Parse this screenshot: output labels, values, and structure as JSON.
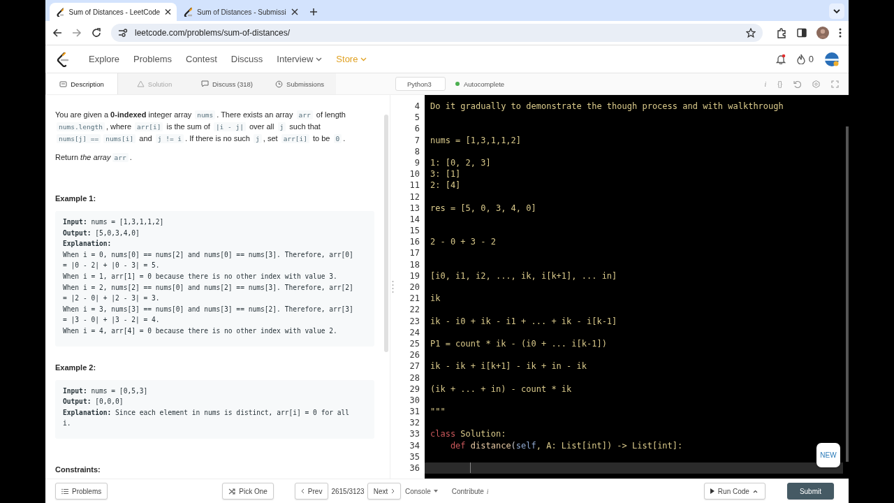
{
  "browser": {
    "tabs": [
      {
        "title": "Sum of Distances - LeetCode",
        "selected": true
      },
      {
        "title": "Sum of Distances - Submissi",
        "selected": false
      }
    ],
    "url": "leetcode.com/problems/sum-of-distances/"
  },
  "nav": {
    "items": [
      {
        "label": "Explore",
        "dropdown": false,
        "highlighted": false
      },
      {
        "label": "Problems",
        "dropdown": false,
        "highlighted": false
      },
      {
        "label": "Contest",
        "dropdown": false,
        "highlighted": false
      },
      {
        "label": "Discuss",
        "dropdown": false,
        "highlighted": false
      },
      {
        "label": "Interview",
        "dropdown": true,
        "highlighted": false
      },
      {
        "label": "Store",
        "dropdown": true,
        "highlighted": true
      }
    ],
    "streak": "0"
  },
  "panel_tabs": [
    {
      "label": "Description",
      "selected": true,
      "disabled": false
    },
    {
      "label": "Solution",
      "selected": false,
      "disabled": true
    },
    {
      "label": "Discuss (318)",
      "selected": false,
      "disabled": false
    },
    {
      "label": "Submissions",
      "selected": false,
      "disabled": false
    }
  ],
  "description": {
    "paragraphs": [
      [
        {
          "text": "You are given a ",
          "kind": "text"
        },
        {
          "text": "0-indexed",
          "kind": "bold"
        },
        {
          "text": " integer array ",
          "kind": "text"
        },
        {
          "text": "nums",
          "kind": "code"
        },
        {
          "text": ". There exists an array ",
          "kind": "text"
        },
        {
          "text": "arr",
          "kind": "code"
        },
        {
          "text": " of length ",
          "kind": "text"
        },
        {
          "text": "nums.length",
          "kind": "code"
        },
        {
          "text": ", where ",
          "kind": "text"
        },
        {
          "text": "arr[i]",
          "kind": "code"
        },
        {
          "text": " is the sum of ",
          "kind": "text"
        },
        {
          "text": "|i - j|",
          "kind": "code"
        },
        {
          "text": " over all ",
          "kind": "text"
        },
        {
          "text": "j",
          "kind": "code"
        },
        {
          "text": " such that ",
          "kind": "text"
        },
        {
          "text": "nums[j] ==",
          "kind": "code"
        },
        {
          "text": "nums[i]",
          "kind": "code"
        },
        {
          "text": " and ",
          "kind": "text"
        },
        {
          "text": "j != i",
          "kind": "code"
        },
        {
          "text": ". If there is no such ",
          "kind": "text"
        },
        {
          "text": "j",
          "kind": "code"
        },
        {
          "text": ", set ",
          "kind": "text"
        },
        {
          "text": "arr[i]",
          "kind": "code"
        },
        {
          "text": " to be ",
          "kind": "text"
        },
        {
          "text": "0",
          "kind": "code"
        },
        {
          "text": ".",
          "kind": "text"
        }
      ],
      [
        {
          "text": "Return ",
          "kind": "text"
        },
        {
          "text": "the array",
          "kind": "italic"
        },
        {
          "text": "arr",
          "kind": "code"
        },
        {
          "text": ".",
          "kind": "text"
        }
      ]
    ],
    "examples": [
      {
        "title": "Example 1:",
        "lines": [
          "**Input:** nums = [1,3,1,1,2]",
          "**Output:** [5,0,3,4,0]",
          "**Explanation:**",
          "When i = 0, nums[0] == nums[2] and nums[0] == nums[3]. Therefore, arr[0]",
          "= |0 - 2| + |0 - 3| = 5.",
          "When i = 1, arr[1] = 0 because there is no other index with value 3.",
          "When i = 2, nums[2] == nums[0] and nums[2] == nums[3]. Therefore, arr[2]",
          "= |2 - 0| + |2 - 3| = 3.",
          "When i = 3, nums[3] == nums[0] and nums[3] == nums[2]. Therefore, arr[3]",
          "= |3 - 0| + |3 - 2| = 4.",
          "When i = 4, arr[4] = 0 because there is no other index with value 2."
        ]
      },
      {
        "title": "Example 2:",
        "lines": [
          "**Input:** nums = [0,5,3]",
          "**Output:** [0,0,0]",
          "**Explanation:** Since each element in nums is distinct, arr[i] = 0 for all",
          "i."
        ]
      }
    ],
    "constraints_title": "Constraints:"
  },
  "editor": {
    "language": "Python3",
    "autocomplete": {
      "label": "Autocomplete",
      "on": true
    },
    "tools": [
      "i",
      "{}"
    ],
    "badge": "NEW",
    "lines": [
      {
        "number": "4",
        "active": false,
        "tokens": [
          {
            "text": "Do it gradually to demonstrate the though process and with walkthrough",
            "kind": "string"
          }
        ]
      },
      {
        "number": "5",
        "active": false
      },
      {
        "number": "6",
        "active": false
      },
      {
        "number": "7",
        "active": false,
        "tokens": [
          {
            "text": "nums = [1,3,1,1,2]",
            "kind": "string"
          }
        ]
      },
      {
        "number": "8",
        "active": false
      },
      {
        "number": "9",
        "active": false,
        "tokens": [
          {
            "text": "1: [0, 2, 3]",
            "kind": "string"
          }
        ]
      },
      {
        "number": "10",
        "active": false,
        "tokens": [
          {
            "text": "3: [1]",
            "kind": "string"
          }
        ]
      },
      {
        "number": "11",
        "active": false,
        "tokens": [
          {
            "text": "2: [4]",
            "kind": "string"
          }
        ]
      },
      {
        "number": "12",
        "active": false
      },
      {
        "number": "13",
        "active": false,
        "tokens": [
          {
            "text": "res = [5, 0, 3, 4, 0]",
            "kind": "string"
          }
        ]
      },
      {
        "number": "14",
        "active": false
      },
      {
        "number": "15",
        "active": false
      },
      {
        "number": "16",
        "active": false,
        "tokens": [
          {
            "text": "2 - 0 + 3 - 2",
            "kind": "string"
          }
        ]
      },
      {
        "number": "17",
        "active": false
      },
      {
        "number": "18",
        "active": false
      },
      {
        "number": "19",
        "active": false,
        "tokens": [
          {
            "text": "[i0, i1, i2, ..., ik, i[k+1], ... in]",
            "kind": "string"
          }
        ]
      },
      {
        "number": "20",
        "active": false
      },
      {
        "number": "21",
        "active": false,
        "tokens": [
          {
            "text": "ik",
            "kind": "string"
          }
        ]
      },
      {
        "number": "22",
        "active": false
      },
      {
        "number": "23",
        "active": false,
        "tokens": [
          {
            "text": "ik - i0 + ik - i1 + ... + ik - i[k-1]",
            "kind": "string"
          }
        ]
      },
      {
        "number": "24",
        "active": false
      },
      {
        "number": "25",
        "active": false,
        "tokens": [
          {
            "text": "P1 = count * ik - (i0 + ... i[k-1])",
            "kind": "string"
          }
        ]
      },
      {
        "number": "26",
        "active": false
      },
      {
        "number": "27",
        "active": false,
        "tokens": [
          {
            "text": "ik - ik + i[k+1] - ik + in - ik",
            "kind": "string"
          }
        ]
      },
      {
        "number": "28",
        "active": false
      },
      {
        "number": "29",
        "active": false,
        "tokens": [
          {
            "text": "(ik + ... + in) - count * ik",
            "kind": "string"
          }
        ]
      },
      {
        "number": "30",
        "active": false
      },
      {
        "number": "31",
        "active": false,
        "tokens": [
          {
            "text": "\"\"\"",
            "kind": "string"
          }
        ]
      },
      {
        "number": "32",
        "active": false
      },
      {
        "number": "33",
        "active": false,
        "tokens": [
          {
            "text": "class",
            "kind": "keyword"
          },
          {
            "text": " Solution:",
            "kind": "string"
          }
        ]
      },
      {
        "number": "34",
        "active": false,
        "tokens": [
          {
            "text": "    def",
            "kind": "keyword"
          },
          {
            "text": " distance",
            "kind": "name"
          },
          {
            "text": "(",
            "kind": "plain"
          },
          {
            "text": "self",
            "kind": "self"
          },
          {
            "text": ", A: List[int]) -> List[int]:",
            "kind": "string"
          }
        ]
      },
      {
        "number": "35",
        "active": false
      },
      {
        "number": "36",
        "active": true
      }
    ]
  },
  "footer": {
    "problems": "Problems",
    "pick_one": "Pick One",
    "prev": "Prev",
    "counter": "2615/3123",
    "next": "Next",
    "console": "Console",
    "contribute": "Contribute",
    "contribute_mark": "i",
    "run_code": "Run Code",
    "submit": "Submit"
  }
}
